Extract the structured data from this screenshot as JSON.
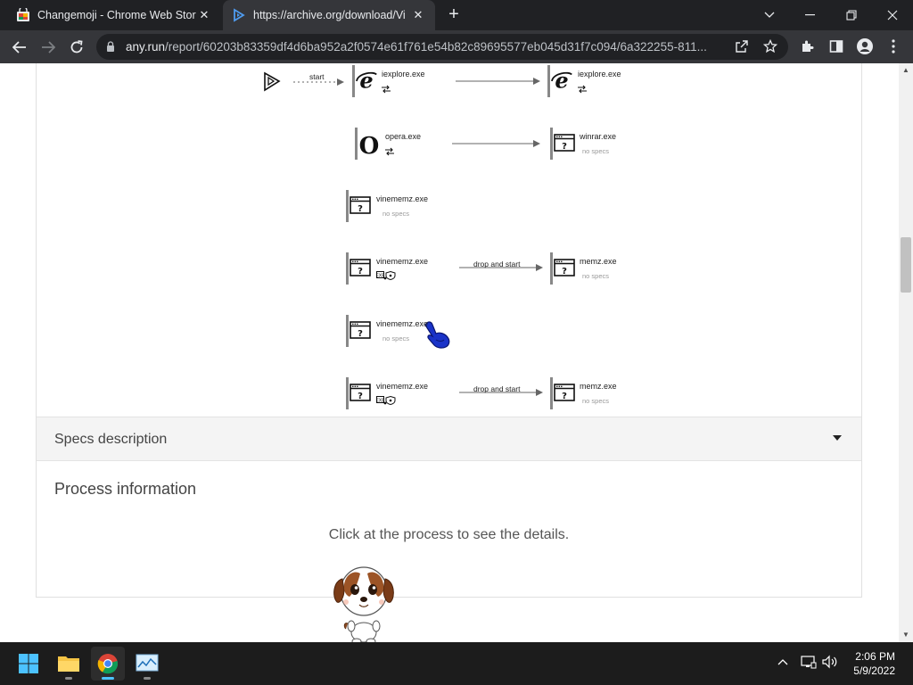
{
  "browser": {
    "tabs": [
      {
        "title": "Changemoji - Chrome Web Store",
        "active": false
      },
      {
        "title": "https://archive.org/download/Vi",
        "active": true
      }
    ],
    "url_host": "any.run",
    "url_path": "/report/60203b83359df4d6ba952a2f0574e61f761e54b82c89695577eb045d31f7c094/6a322255-811..."
  },
  "graph": {
    "start_label": "start",
    "rows": [
      {
        "left": {
          "name": "iexplore.exe",
          "icon": "ie-icon",
          "spec": ""
        },
        "edge": "",
        "right": {
          "name": "iexplore.exe",
          "icon": "ie-icon",
          "spec": ""
        }
      },
      {
        "left": {
          "name": "opera.exe",
          "icon": "opera-icon",
          "spec": ""
        },
        "edge": "",
        "right": {
          "name": "winrar.exe",
          "icon": "unknown-app-icon",
          "spec": "no specs"
        }
      },
      {
        "left": {
          "name": "vinememz.exe",
          "icon": "unknown-app-icon",
          "spec": "no specs"
        }
      },
      {
        "left": {
          "name": "vinememz.exe",
          "icon": "unknown-app-icon",
          "spec": ""
        },
        "edge": "drop and start",
        "right": {
          "name": "memz.exe",
          "icon": "unknown-app-icon",
          "spec": "no specs"
        }
      },
      {
        "left": {
          "name": "vinememz.exe",
          "icon": "unknown-app-icon",
          "spec": "no specs"
        }
      },
      {
        "left": {
          "name": "vinememz.exe",
          "icon": "unknown-app-icon",
          "spec": ""
        },
        "edge": "drop and start",
        "right": {
          "name": "memz.exe",
          "icon": "unknown-app-icon",
          "spec": "no specs"
        }
      }
    ]
  },
  "specs": {
    "label": "Specs description"
  },
  "process_info": {
    "title": "Process information",
    "hint": "Click at the process to see the details."
  },
  "taskbar": {
    "time": "2:06 PM",
    "date": "5/9/2022"
  },
  "colors": {
    "chrome_dark": "#202124",
    "chrome_toolbar": "#35363a",
    "accent_blue": "#1a73e8",
    "taskbar": "#1c1c1c"
  }
}
